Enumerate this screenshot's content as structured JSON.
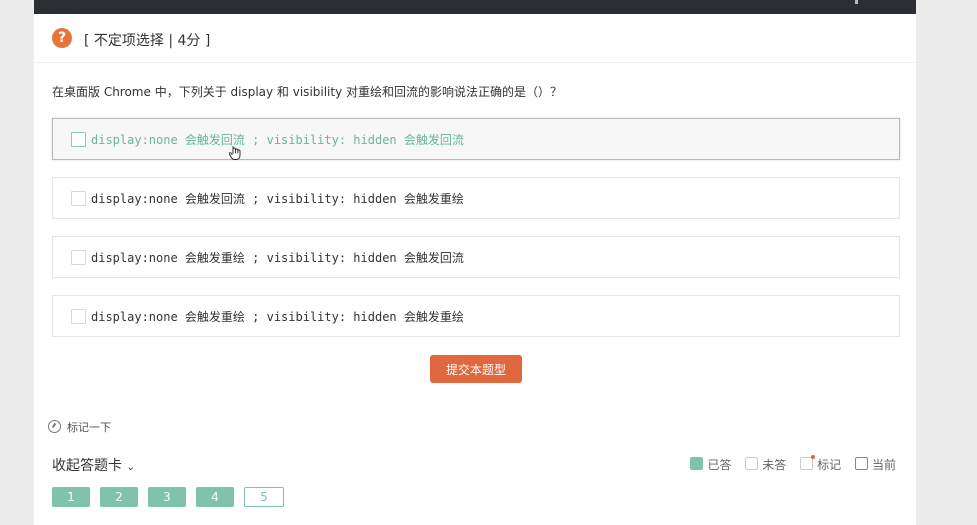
{
  "question": {
    "type_label": "[ 不定项选择 | 4分 ]",
    "stem": "在桌面版 Chrome 中，下列关于 display 和 visibility 对重绘和回流的影响说法正确的是（）？",
    "options": [
      {
        "text": "display:none 会触发回流 ; visibility: hidden 会触发回流",
        "hovered": true
      },
      {
        "text": "display:none 会触发回流 ; visibility: hidden 会触发重绘",
        "hovered": false
      },
      {
        "text": "display:none 会触发重绘 ; visibility: hidden 会触发回流",
        "hovered": false
      },
      {
        "text": "display:none 会触发重绘 ; visibility: hidden 会触发重绘",
        "hovered": false
      }
    ],
    "submit_label": "提交本题型",
    "mark_label": "标记一下"
  },
  "answer_sheet": {
    "collapse_label": "收起答题卡",
    "legend": {
      "answered": "已答",
      "unanswered": "未答",
      "marked": "标记",
      "current": "当前"
    },
    "cards": [
      {
        "label": "1",
        "state": "answered"
      },
      {
        "label": "2",
        "state": "answered"
      },
      {
        "label": "3",
        "state": "answered"
      },
      {
        "label": "4",
        "state": "answered"
      },
      {
        "label": "5",
        "state": "current"
      }
    ]
  },
  "colors": {
    "accent": "#e0683f",
    "answered": "#7fc3ab",
    "topbar": "#2b2f33"
  }
}
